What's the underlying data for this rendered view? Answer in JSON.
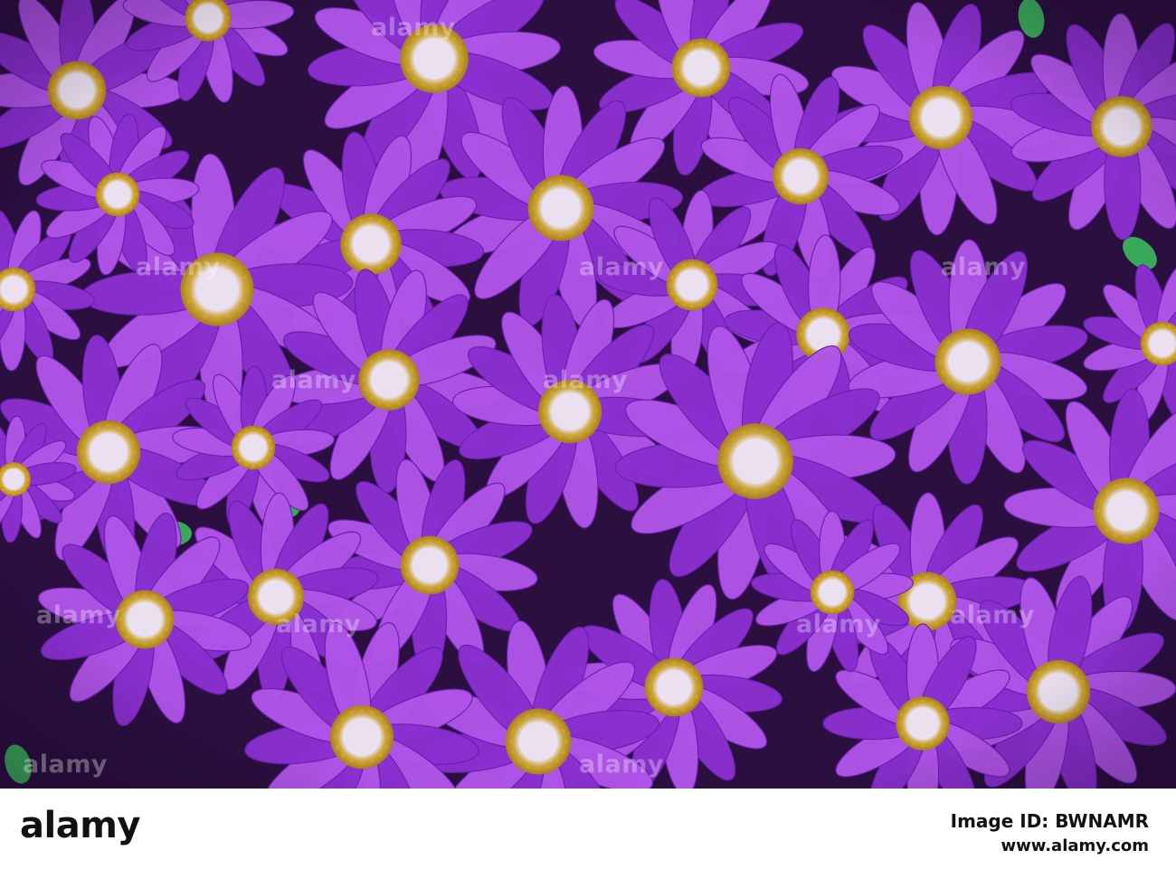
{
  "photo": {
    "subject": "cineraria-flower-cluster",
    "palette": {
      "background": "#2a0f3f",
      "petal_dark": "#6a1fb0",
      "petal_mid": "#8a2fd0",
      "petal_light": "#b055e8",
      "center_ring": "#d8a020",
      "center_disc": "#eae0f0",
      "leaf": "#3aa85a"
    },
    "watermark_text": "alamy"
  },
  "footer": {
    "logo_text": "alamy",
    "image_id_line": "Image ID: BWNAMR",
    "url": "www.alamy.com"
  }
}
